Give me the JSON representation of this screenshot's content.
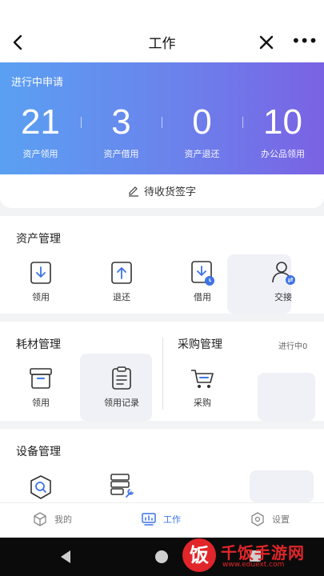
{
  "nav": {
    "back_icon": "chevron-left-icon",
    "title": "工作",
    "close_icon": "close-icon",
    "more_icon": "more-icon",
    "more_glyph": "•••"
  },
  "hero": {
    "title": "进行中申请",
    "stats": [
      {
        "value": "21",
        "label": "资产领用"
      },
      {
        "value": "3",
        "label": "资产借用"
      },
      {
        "value": "0",
        "label": "资产退还"
      },
      {
        "value": "10",
        "label": "办公品领用"
      }
    ],
    "gradient": [
      "#5aa0f2",
      "#7a62e4"
    ]
  },
  "sign": {
    "label": "待收货签字",
    "icon": "pencil-icon"
  },
  "asset": {
    "title": "资产管理",
    "items": [
      {
        "label": "领用",
        "icon": "download-box-icon"
      },
      {
        "label": "退还",
        "icon": "upload-box-icon"
      },
      {
        "label": "借用",
        "icon": "borrow-clock-icon"
      },
      {
        "label": "交接",
        "icon": "user-transfer-icon"
      }
    ]
  },
  "consumable": {
    "title": "耗材管理",
    "items": [
      {
        "label": "领用",
        "icon": "archive-box-icon"
      },
      {
        "label": "领用记录",
        "icon": "clipboard-list-icon"
      }
    ]
  },
  "purchase": {
    "title": "采购管理",
    "status": "进行中0",
    "items": [
      {
        "label": "采购",
        "icon": "cart-icon"
      }
    ]
  },
  "device": {
    "title": "设备管理",
    "items": [
      {
        "icon": "device-search-icon"
      },
      {
        "icon": "server-wrench-icon"
      }
    ]
  },
  "tabs": [
    {
      "label": "我的",
      "icon": "cube-icon"
    },
    {
      "label": "工作",
      "icon": "monitor-chart-icon"
    },
    {
      "label": "设置",
      "icon": "hex-gear-icon"
    }
  ],
  "accent": "#3d73e6",
  "watermark": {
    "brand": "千饭手游网",
    "logo_glyph": "饭",
    "url": "www.eduext.com"
  }
}
